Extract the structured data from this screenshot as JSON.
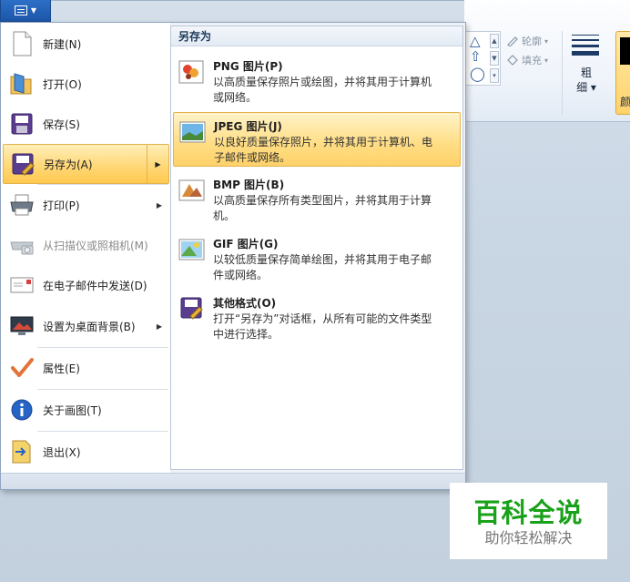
{
  "file_tab": {
    "icon": "menu-icon"
  },
  "ribbon": {
    "outline_label": "轮廓",
    "fill_label": "填充",
    "thickness_line1": "粗",
    "thickness_line2": "细",
    "color_label": "颜"
  },
  "menu": {
    "items": [
      {
        "label": "新建(N)",
        "icon": "new-document-icon"
      },
      {
        "label": "打开(O)",
        "icon": "open-folder-icon"
      },
      {
        "label": "保存(S)",
        "icon": "save-disk-icon"
      },
      {
        "label": "另存为(A)",
        "icon": "save-as-icon",
        "active": true,
        "submenu": true
      },
      {
        "label": "打印(P)",
        "icon": "printer-icon",
        "submenu": true
      },
      {
        "label": "从扫描仪或照相机(M)",
        "icon": "scanner-camera-icon",
        "disabled": true
      },
      {
        "label": "在电子邮件中发送(D)",
        "icon": "email-icon"
      },
      {
        "label": "设置为桌面背景(B)",
        "icon": "desktop-background-icon",
        "submenu": true
      },
      {
        "label": "属性(E)",
        "icon": "properties-check-icon"
      },
      {
        "label": "关于画图(T)",
        "icon": "info-icon"
      },
      {
        "label": "退出(X)",
        "icon": "exit-icon"
      }
    ]
  },
  "save_as": {
    "title": "另存为",
    "options": [
      {
        "title": "PNG 图片(P)",
        "description": "以高质量保存照片或绘图，并将其用于计算机或网络。",
        "icon": "png-image-icon"
      },
      {
        "title": "JPEG 图片(J)",
        "description": "以良好质量保存照片，并将其用于计算机、电子邮件或网络。",
        "icon": "jpeg-image-icon",
        "active": true
      },
      {
        "title": "BMP 图片(B)",
        "description": "以高质量保存所有类型图片，并将其用于计算机。",
        "icon": "bmp-image-icon"
      },
      {
        "title": "GIF 图片(G)",
        "description": "以较低质量保存简单绘图，并将其用于电子邮件或网络。",
        "icon": "gif-image-icon"
      },
      {
        "title": "其他格式(O)",
        "description": "打开“另存为”对话框，从所有可能的文件类型中进行选择。",
        "icon": "other-formats-icon"
      }
    ]
  },
  "watermark": {
    "title": "百科全说",
    "subtitle": "助你轻松解决"
  }
}
